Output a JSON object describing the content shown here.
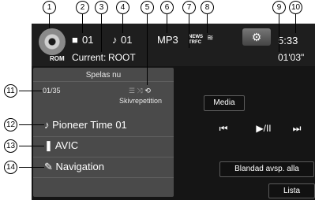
{
  "callouts": [
    "1",
    "2",
    "3",
    "4",
    "5",
    "6",
    "7",
    "8",
    "9",
    "10",
    "11",
    "12",
    "13",
    "14"
  ],
  "status": {
    "disc_label": "ROM",
    "folder_number": "01",
    "track_number": "01",
    "folder_prefix": "Current:",
    "folder_name": "ROOT",
    "format": "MP3",
    "news_label": "NEWS",
    "trfc_label": "TRFC",
    "clock": "5:33",
    "elapsed": "01'03\""
  },
  "panel": {
    "header": "Spelas nu",
    "track_position": "01/35",
    "repeat_label": "Skivrepetition",
    "rows": [
      {
        "icon": "music-note-icon",
        "text": "Pioneer Time 01"
      },
      {
        "icon": "artist-icon",
        "text": "AVIC"
      },
      {
        "icon": "album-icon",
        "text": "Navigation"
      }
    ]
  },
  "controls": {
    "media": "Media",
    "prev": "⏮",
    "play_pause": "▶/II",
    "next": "⏭",
    "shuffle_all": "Blandad avsp. alla",
    "list": "Lista"
  }
}
